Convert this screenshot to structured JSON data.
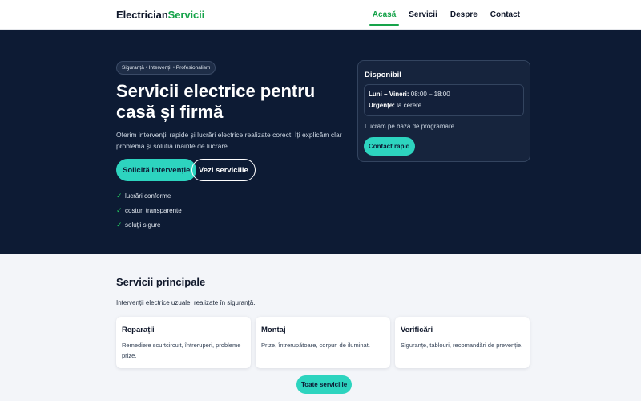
{
  "header": {
    "logo_part1": "Electrician",
    "logo_part2": "Servicii",
    "nav": [
      {
        "label": "Acasă",
        "active": true
      },
      {
        "label": "Servicii",
        "active": false
      },
      {
        "label": "Despre",
        "active": false
      },
      {
        "label": "Contact",
        "active": false
      }
    ]
  },
  "hero": {
    "badge": "Siguranță • Intervenții • Profesionalism",
    "title": "Servicii electrice pentru casă și firmă",
    "description": "Oferim intervenții rapide și lucrări electrice realizate corect. Îți explicăm clar problema și soluția înainte de lucrare.",
    "primary_button": "Solicită intervenție",
    "secondary_button": "Vezi serviciile",
    "checks": [
      {
        "icon": "check-icon",
        "text": "lucrări conforme"
      },
      {
        "icon": "check-icon",
        "text": "costuri transparente"
      },
      {
        "icon": "check-icon",
        "text": "soluții sigure"
      }
    ]
  },
  "availability": {
    "title": "Disponibil",
    "schedule_label": "Luni – Vineri:",
    "schedule_value": "08:00 – 18:00",
    "urgent_label": "Urgențe:",
    "urgent_value": "la cerere",
    "note": "Lucrăm pe bază de programare.",
    "contact_button": "Contact rapid"
  },
  "services": {
    "title": "Servicii principale",
    "subtitle": "Intervenții electrice uzuale, realizate în siguranță.",
    "items": [
      {
        "name": "Reparații",
        "description": "Remediere scurtcircuit, întreruperi, probleme prize."
      },
      {
        "name": "Montaj",
        "description": "Prize, întrerupătoare, corpuri de iluminat."
      },
      {
        "name": "Verificări",
        "description": "Siguranțe, tablouri, recomandări de prevenție."
      }
    ],
    "all_button": "Toate serviciile"
  },
  "colors": {
    "accent": "#2dd4bf",
    "brand_green": "#16a34a",
    "hero_bg": "#0d1b34",
    "check_green": "#22c55e"
  }
}
